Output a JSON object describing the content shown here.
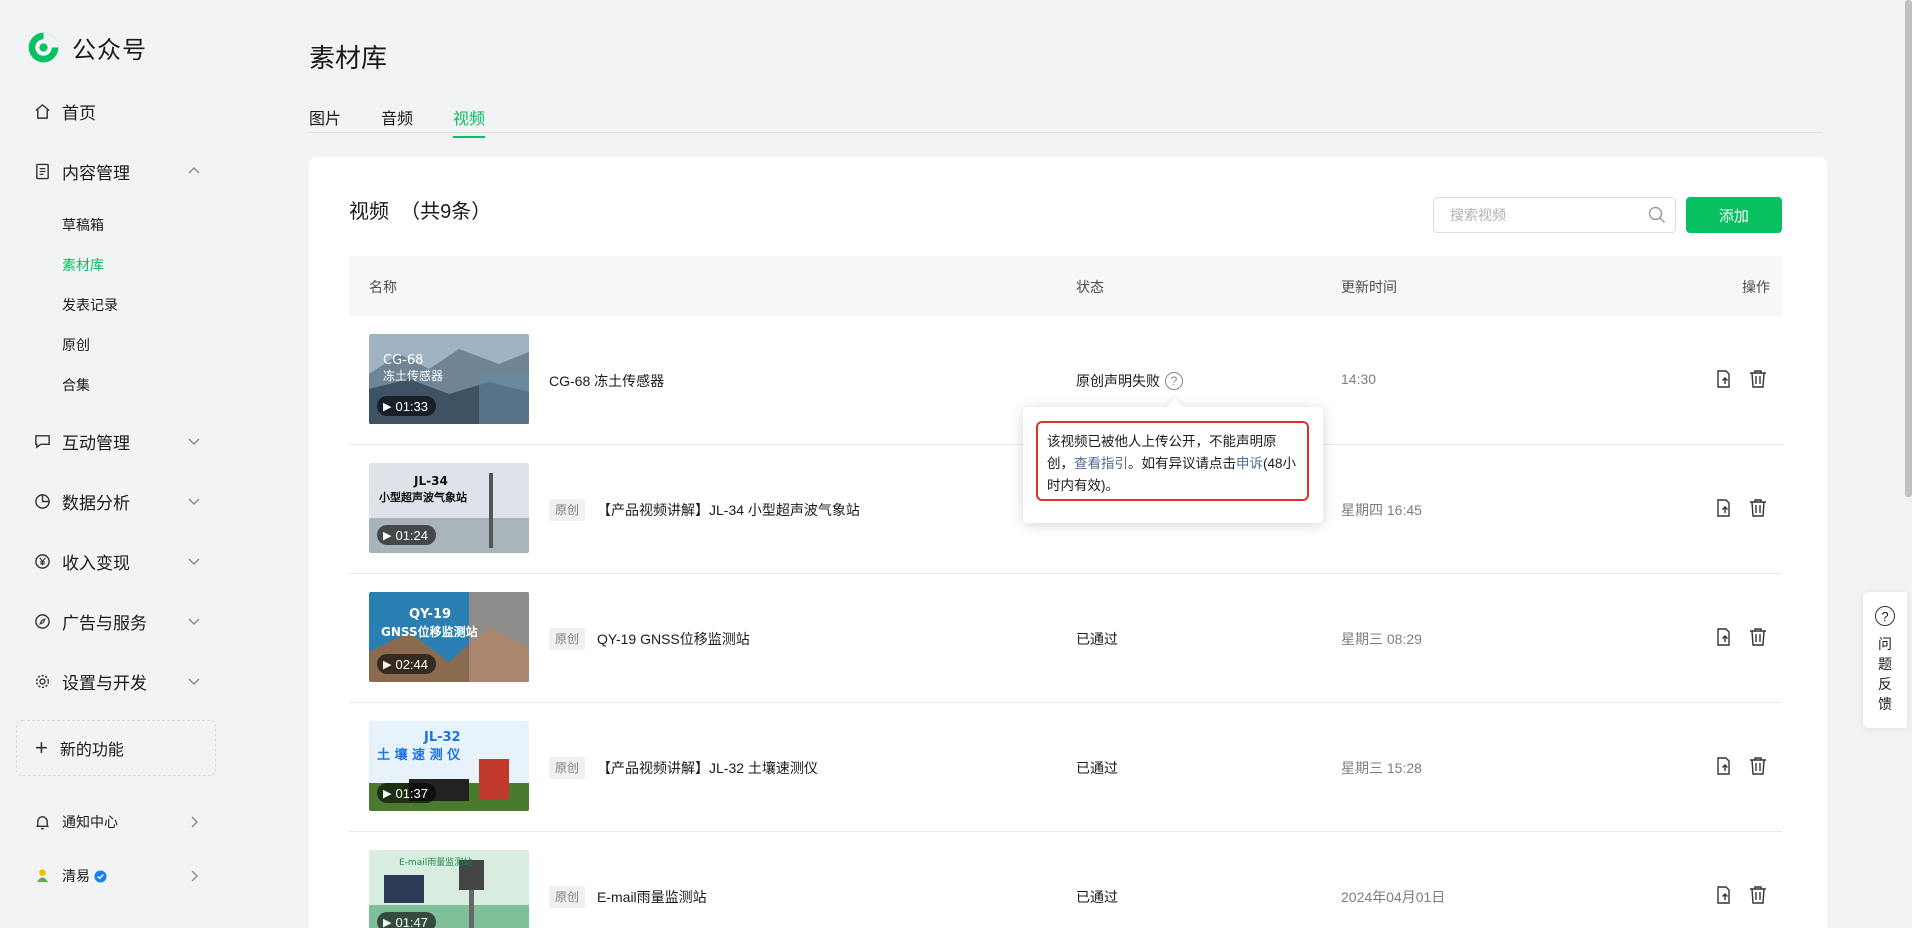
{
  "app": {
    "name": "公众号"
  },
  "sidebar": {
    "home": "首页",
    "content_mgmt": "内容管理",
    "sub_items": [
      "草稿箱",
      "素材库",
      "发表记录",
      "原创",
      "合集"
    ],
    "interaction": "互动管理",
    "analytics": "数据分析",
    "monetize": "收入变现",
    "ads": "广告与服务",
    "settings": "设置与开发",
    "new_feature": "新的功能",
    "notifications": "通知中心",
    "account": "清易"
  },
  "page": {
    "title": "素材库"
  },
  "tabs": [
    "图片",
    "音频",
    "视频"
  ],
  "list": {
    "title": "视频  （共9条）",
    "search_placeholder": "搜索视频",
    "add_label": "添加",
    "headers": {
      "name": "名称",
      "status": "状态",
      "time": "更新时间",
      "ops": "操作"
    },
    "rows": [
      {
        "thumb_title": "CG-68\n冻土传感器",
        "duration": "01:33",
        "original": false,
        "name": "CG-68 冻土传感器",
        "status": "原创声明失败",
        "time": "14:30"
      },
      {
        "thumb_title": "JL-34\n小型超声波气象站",
        "duration": "01:24",
        "original": true,
        "name": "【产品视频讲解】JL-34 小型超声波气象站",
        "status": "",
        "time": "星期四 16:45"
      },
      {
        "thumb_title": "QY-19\nGNSS位移监测站",
        "duration": "02:44",
        "original": true,
        "name": "QY-19 GNSS位移监测站",
        "status": "已通过",
        "time": "星期三 08:29"
      },
      {
        "thumb_title": "JL-32\n土壤速测仪",
        "duration": "01:37",
        "original": true,
        "name": "【产品视频讲解】JL-32 土壤速测仪",
        "status": "已通过",
        "time": "星期三 15:28"
      },
      {
        "thumb_title": "E-mail雨量监测站",
        "duration": "01:47",
        "original": true,
        "name": "E-mail雨量监测站",
        "status": "已通过",
        "time": "2024年04月01日"
      }
    ],
    "original_tag": "原创"
  },
  "tooltip": {
    "text1": "该视频已被他人上传公开，不能声明原创，",
    "link1": "查看指引",
    "text2": "。如有异议请点击",
    "link2": "申诉",
    "text3": "(48小时内有效)。"
  },
  "feedback": {
    "label": "问题反馈"
  },
  "colors": {
    "accent": "#07c160",
    "link": "#576b95",
    "highlight": "#e0322a"
  }
}
